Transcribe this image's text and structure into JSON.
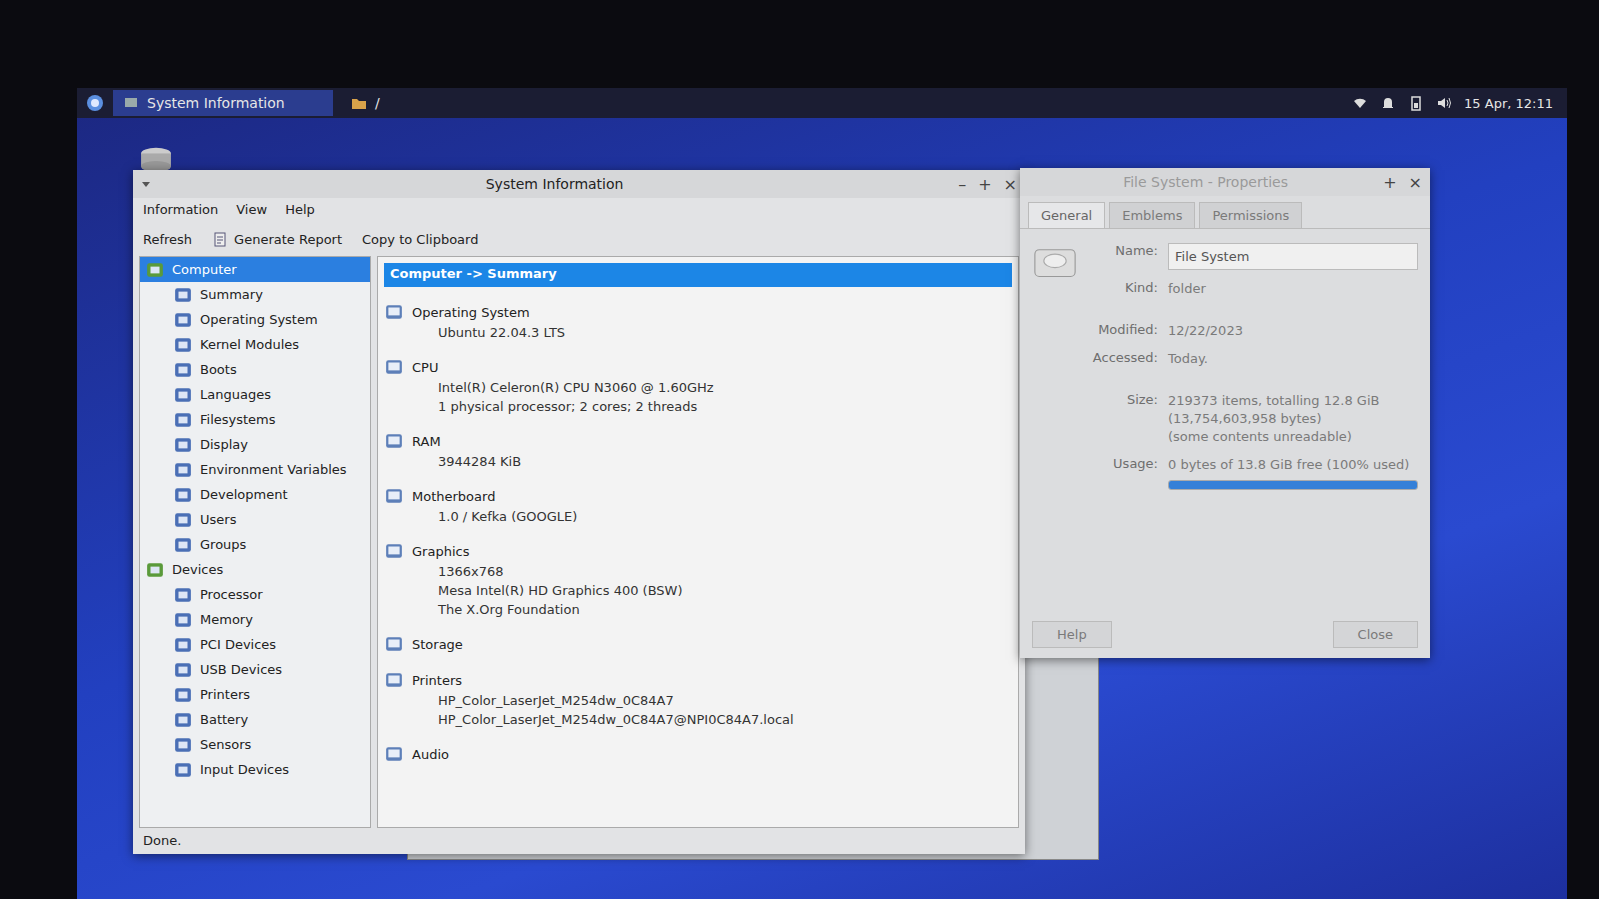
{
  "panel": {
    "tasks": [
      {
        "label": "System Information",
        "selected": true
      },
      {
        "label": "/",
        "selected": false
      }
    ],
    "clock": "15 Apr, 12:11"
  },
  "sysinfo": {
    "title": "System Information",
    "controls": [
      "–",
      "+",
      "×"
    ],
    "menu": [
      "Information",
      "View",
      "Help"
    ],
    "toolbar": [
      "Refresh",
      "Generate Report",
      "Copy to Clipboard"
    ],
    "tree": [
      {
        "label": "Computer",
        "kind": "group",
        "selected": true
      },
      {
        "label": "Summary",
        "kind": "item",
        "selected": false
      },
      {
        "label": "Operating System",
        "kind": "item",
        "selected": false
      },
      {
        "label": "Kernel Modules",
        "kind": "item",
        "selected": false
      },
      {
        "label": "Boots",
        "kind": "item",
        "selected": false
      },
      {
        "label": "Languages",
        "kind": "item",
        "selected": false
      },
      {
        "label": "Filesystems",
        "kind": "item",
        "selected": false
      },
      {
        "label": "Display",
        "kind": "item",
        "selected": false
      },
      {
        "label": "Environment Variables",
        "kind": "item",
        "selected": false
      },
      {
        "label": "Development",
        "kind": "item",
        "selected": false
      },
      {
        "label": "Users",
        "kind": "item",
        "selected": false
      },
      {
        "label": "Groups",
        "kind": "item",
        "selected": false
      },
      {
        "label": "Devices",
        "kind": "group",
        "selected": false
      },
      {
        "label": "Processor",
        "kind": "item",
        "selected": false
      },
      {
        "label": "Memory",
        "kind": "item",
        "selected": false
      },
      {
        "label": "PCI Devices",
        "kind": "item",
        "selected": false
      },
      {
        "label": "USB Devices",
        "kind": "item",
        "selected": false
      },
      {
        "label": "Printers",
        "kind": "item",
        "selected": false
      },
      {
        "label": "Battery",
        "kind": "item",
        "selected": false
      },
      {
        "label": "Sensors",
        "kind": "item",
        "selected": false
      },
      {
        "label": "Input Devices",
        "kind": "item",
        "selected": false
      }
    ],
    "header": "Computer -> Summary",
    "sections": [
      {
        "title": "Operating System",
        "lines": [
          "Ubuntu 22.04.3 LTS"
        ]
      },
      {
        "title": "CPU",
        "lines": [
          "Intel(R) Celeron(R) CPU  N3060  @ 1.60GHz",
          "1 physical processor; 2 cores; 2 threads"
        ]
      },
      {
        "title": "RAM",
        "lines": [
          "3944284 KiB"
        ]
      },
      {
        "title": "Motherboard",
        "lines": [
          "1.0 / Kefka (GOOGLE)"
        ]
      },
      {
        "title": "Graphics",
        "lines": [
          "1366x768",
          "Mesa Intel(R) HD Graphics 400 (BSW)",
          "The X.Org Foundation"
        ]
      },
      {
        "title": "Storage",
        "lines": []
      },
      {
        "title": "Printers",
        "lines": [
          "HP_Color_LaserJet_M254dw_0C84A7",
          "HP_Color_LaserJet_M254dw_0C84A7@NPI0C84A7.local"
        ]
      },
      {
        "title": "Audio",
        "lines": []
      }
    ],
    "status": "Done."
  },
  "properties": {
    "title": "File System - Properties",
    "controls": [
      "+",
      "×"
    ],
    "tabs": [
      {
        "label": "General",
        "selected": true
      },
      {
        "label": "Emblems",
        "selected": false
      },
      {
        "label": "Permissions",
        "selected": false
      }
    ],
    "fields": [
      {
        "label": "Name:",
        "kind": "entry",
        "lines": [
          "File System"
        ]
      },
      {
        "label": "Kind:",
        "kind": "text",
        "lines": [
          "folder"
        ]
      },
      {
        "label": "Modified:",
        "kind": "text",
        "lines": [
          "12/22/2023"
        ]
      },
      {
        "label": "Accessed:",
        "kind": "text",
        "lines": [
          "Today."
        ]
      },
      {
        "label": "Size:",
        "kind": "text",
        "lines": [
          "219373 items, totalling 12.8 GiB",
          "(13,754,603,958 bytes)",
          "(some contents unreadable)"
        ]
      },
      {
        "label": "Usage:",
        "kind": "usage",
        "lines": [
          "0 bytes of 13.8 GiB free (100% used)"
        ],
        "level": 1
      }
    ],
    "buttons": [
      "Help",
      "Close"
    ]
  }
}
